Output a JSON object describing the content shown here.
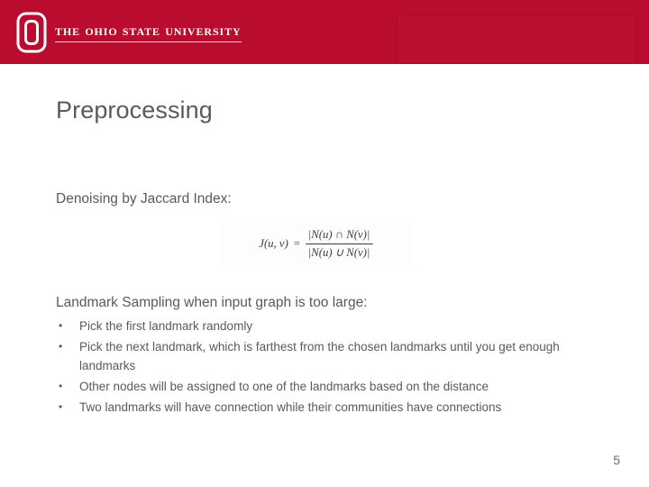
{
  "header": {
    "brand_name": "The Ohio State University",
    "logo_icon": "block-o-logo-icon",
    "placeholder_box_label": ""
  },
  "slide": {
    "title": "Preprocessing",
    "page_number": "5",
    "accent_color": "#ba0c2f",
    "text_color": "#5a5a5a"
  },
  "sections": {
    "denoising": {
      "heading": "Denoising by Jaccard Index:",
      "formula": {
        "alt": "J(u,v) = |N(u) ∩ N(v)| / |N(u) ∪ N(v)|",
        "lhs": "J(u, v)",
        "equals": "=",
        "numerator": "|N(u) ∩ N(v)|",
        "denominator": "|N(u) ∪ N(v)|"
      }
    },
    "landmark": {
      "heading": "Landmark Sampling when input graph is too large:",
      "bullet_marker": "•",
      "bullets": [
        "Pick the first landmark randomly",
        "Pick the next landmark, which is farthest from the chosen landmarks until you get enough landmarks",
        "Other nodes will be assigned to one of the landmarks based on the distance",
        "Two landmarks will have connection while their communities have connections"
      ]
    }
  }
}
